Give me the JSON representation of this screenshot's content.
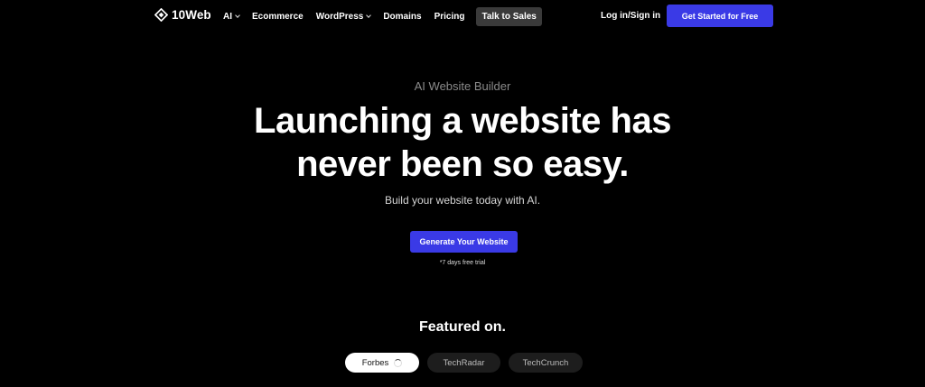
{
  "nav": {
    "logo_text": "10Web",
    "links": [
      {
        "label": "AI",
        "dropdown": true
      },
      {
        "label": "Ecommerce",
        "dropdown": false
      },
      {
        "label": "WordPress",
        "dropdown": true
      },
      {
        "label": "Domains",
        "dropdown": false
      },
      {
        "label": "Pricing",
        "dropdown": false
      }
    ],
    "talk_to_sales": "Talk to Sales",
    "login": "Log in/Sign in",
    "cta": "Get Started for Free"
  },
  "hero": {
    "eyebrow": "AI Website Builder",
    "headline_line1": "Launching a website has",
    "headline_line2": "never been so easy.",
    "subhead": "Build your website today with AI.",
    "cta": "Generate Your Website",
    "trial_note": "*7 days free trial"
  },
  "featured": {
    "title": "Featured on.",
    "pills": [
      {
        "label": "Forbes",
        "active": true
      },
      {
        "label": "TechRadar",
        "active": false
      },
      {
        "label": "TechCrunch",
        "active": false
      }
    ]
  },
  "colors": {
    "background": "#000000",
    "accent": "#3a3ae6",
    "talk_btn_bg": "#3a3a3a",
    "pill_bg": "#1d1d1d"
  }
}
